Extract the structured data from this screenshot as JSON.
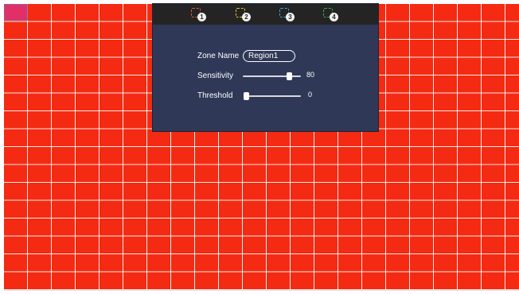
{
  "region_tabs": [
    {
      "number": "1",
      "color": "#e0592a"
    },
    {
      "number": "2",
      "color": "#e6c21f"
    },
    {
      "number": "3",
      "color": "#2aa7d8"
    },
    {
      "number": "4",
      "color": "#3fae45"
    }
  ],
  "grid_color": "#f42a12",
  "form": {
    "zone_name_label": "Zone Name",
    "zone_name_value": "Region1",
    "sensitivity_label": "Sensitivity",
    "sensitivity_value": "80",
    "sensitivity_level": 80,
    "threshold_label": "Threshold",
    "threshold_value": "0",
    "threshold_level": 0
  }
}
